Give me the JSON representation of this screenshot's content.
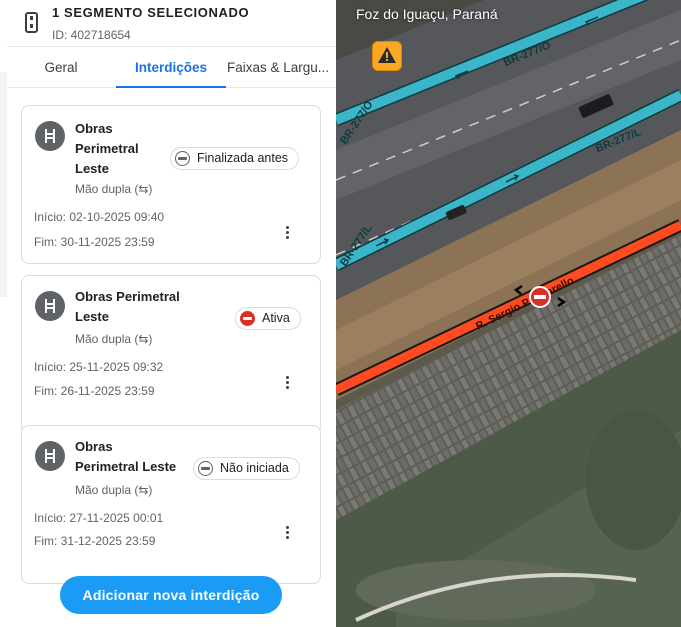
{
  "header": {
    "title": "1 SEGMENTO SELECIONADO",
    "id_text": "ID: 402718654"
  },
  "tabs": [
    {
      "label": "Geral",
      "active": false
    },
    {
      "label": "Interdições",
      "active": true
    },
    {
      "label": "Faixas & Largu...",
      "active": false
    }
  ],
  "closures": [
    {
      "title_lines": [
        "Obras",
        "Perimetral",
        "Leste"
      ],
      "subtitle": "Mão dupla (⇆)",
      "status": "Finalizada antes",
      "status_icon": "minus-circle-outline-icon",
      "start": "Início: 02-10-2025 09:40",
      "end": "Fim: 30-11-2025 23:59"
    },
    {
      "title_lines": [
        "Obras Perimetral",
        "Leste"
      ],
      "subtitle": "Mão dupla (⇆)",
      "status": "Ativa",
      "status_icon": "no-entry-icon",
      "start": "Início: 25-11-2025 09:32",
      "end": "Fim: 26-11-2025 23:59"
    },
    {
      "title_lines": [
        "Obras",
        "Perimetral Leste"
      ],
      "subtitle": "Mão dupla (⇆)",
      "status": "Não iniciada",
      "status_icon": "minus-circle-outline-icon",
      "start": "Início: 27-11-2025 00:01",
      "end": "Fim: 31-12-2025 23:59"
    }
  ],
  "add_button": "Adicionar nova interdição",
  "map": {
    "city": "Foz do Iguaçu, Paraná",
    "road_labels": [
      "BR-277/O",
      "BR-277/L",
      "BR-277/O",
      "BR-277/L",
      "R. Sergio Papparello"
    ],
    "colors": {
      "highway": "#3bb6c9",
      "selected_segment": "#ff4b1f",
      "status_active": "#d93025",
      "accent": "#1a73e8",
      "button": "#1a9bf5",
      "warning": "#f9a825"
    }
  }
}
